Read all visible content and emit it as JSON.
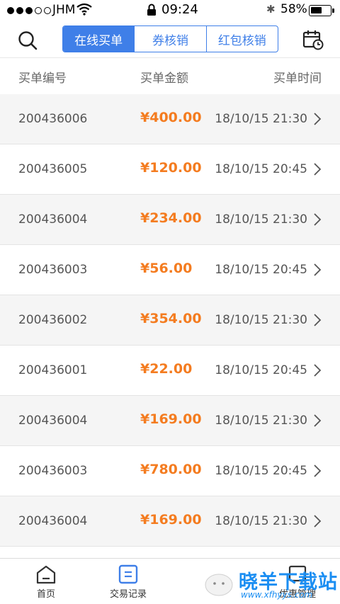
{
  "status_bar": {
    "carrier": "JHM",
    "time": "09:24",
    "battery": "58%",
    "battery_level": 0.58
  },
  "header": {
    "search_icon": "search-icon",
    "calendar_icon": "calendar-clock-icon",
    "tabs": [
      {
        "label": "在线买单",
        "active": true
      },
      {
        "label": "券核销",
        "active": false
      },
      {
        "label": "红包核销",
        "active": false
      }
    ]
  },
  "columns": {
    "id": "买单编号",
    "amount": "买单金额",
    "time": "买单时间"
  },
  "orders": [
    {
      "id": "200436006",
      "amount": "¥400.00",
      "time": "18/10/15 21:30"
    },
    {
      "id": "200436005",
      "amount": "¥120.00",
      "time": "18/10/15 20:45"
    },
    {
      "id": "200436004",
      "amount": "¥234.00",
      "time": "18/10/15 21:30"
    },
    {
      "id": "200436003",
      "amount": "¥56.00",
      "time": "18/10/15 20:45"
    },
    {
      "id": "200436002",
      "amount": "¥354.00",
      "time": "18/10/15 21:30"
    },
    {
      "id": "200436001",
      "amount": "¥22.00",
      "time": "18/10/15 20:45"
    },
    {
      "id": "200436004",
      "amount": "¥169.00",
      "time": "18/10/15 21:30"
    },
    {
      "id": "200436003",
      "amount": "¥780.00",
      "time": "18/10/15 20:45"
    },
    {
      "id": "200436004",
      "amount": "¥169.00",
      "time": "18/10/15 21:30"
    }
  ],
  "tabbar": {
    "home": "首页",
    "trade": "交易记录",
    "manage": "优惠管理"
  },
  "watermark": {
    "text": "晓羊下载站",
    "url": "www.xfhyys.com"
  },
  "colors": {
    "accent": "#3f7fe8",
    "amount": "#f47c20",
    "row_alt": "#f5f5f5"
  }
}
